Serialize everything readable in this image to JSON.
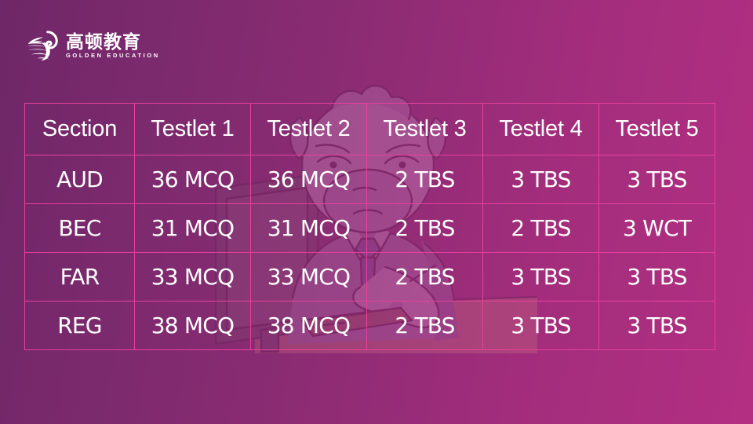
{
  "brand": {
    "logo_icon": "golden-education-swoosh-logo",
    "name_cn": "高顿教育",
    "name_en": "GOLDEN EDUCATION"
  },
  "illustration": {
    "icon": "cartoon-bull-at-desk-illustration",
    "description": "faded cartoon bull character in suit and tie seated at a desk with monitor and keyboard"
  },
  "colors": {
    "background_left": "#6e2768",
    "background_right": "#b32f82",
    "grid_line": "#e8409a",
    "text": "#ffffff"
  },
  "table": {
    "headers": [
      "Section",
      "Testlet 1",
      "Testlet 2",
      "Testlet 3",
      "Testlet 4",
      "Testlet 5"
    ],
    "rows": [
      {
        "section": "AUD",
        "testlet1": "36 MCQ",
        "testlet2": "36 MCQ",
        "testlet3": "2 TBS",
        "testlet4": "3 TBS",
        "testlet5": "3 TBS"
      },
      {
        "section": "BEC",
        "testlet1": "31 MCQ",
        "testlet2": "31 MCQ",
        "testlet3": "2 TBS",
        "testlet4": "2 TBS",
        "testlet5": "3 WCT"
      },
      {
        "section": "FAR",
        "testlet1": "33 MCQ",
        "testlet2": "33 MCQ",
        "testlet3": "2 TBS",
        "testlet4": "3 TBS",
        "testlet5": "3 TBS"
      },
      {
        "section": "REG",
        "testlet1": "38 MCQ",
        "testlet2": "38 MCQ",
        "testlet3": "2 TBS",
        "testlet4": "3 TBS",
        "testlet5": "3 TBS"
      }
    ]
  }
}
